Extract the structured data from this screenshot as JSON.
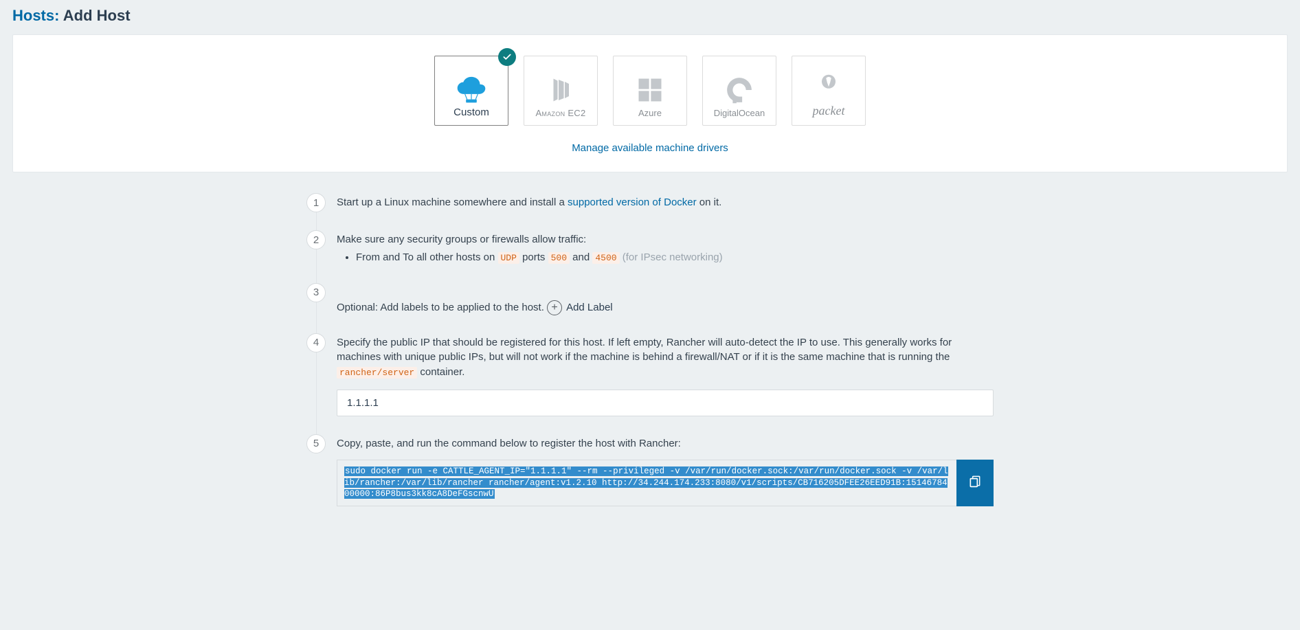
{
  "page": {
    "title_link": "Hosts:",
    "title_rest": " Add Host"
  },
  "drivers": {
    "custom": "Custom",
    "ec2": "Amazon EC2",
    "azure": "Azure",
    "digitalocean": "DigitalOcean",
    "packet": "packet"
  },
  "manage_drivers_link": "Manage available machine drivers",
  "steps": {
    "s1_pre": "Start up a Linux machine somewhere and install a ",
    "s1_link": "supported version of Docker",
    "s1_post": " on it.",
    "s2_intro": "Make sure any security groups or firewalls allow traffic:",
    "s2_li_pre": "From and To all other hosts on ",
    "s2_udp": "UDP",
    "s2_ports_word": " ports ",
    "s2_port1": "500",
    "s2_and": " and ",
    "s2_port2": "4500",
    "s2_note": " (for IPsec networking)",
    "s3": "Optional: Add labels to be applied to the host.",
    "add_label": "Add Label",
    "s4_pre": "Specify the public IP that should be registered for this host. If left empty, Rancher will auto-detect the IP to use. This generally works for machines with unique public IPs, but will not work if the machine is behind a firewall/NAT or if it is the same machine that is running the ",
    "s4_code": "rancher/server",
    "s4_post": " container.",
    "ip_value": "1.1.1.1",
    "s5": "Copy, paste, and run the command below to register the host with Rancher:",
    "cmd": "sudo docker run -e CATTLE_AGENT_IP=\"1.1.1.1\"  --rm --privileged -v /var/run/docker.sock:/var/run/docker.sock -v /var/lib/rancher:/var/lib/rancher rancher/agent:v1.2.10 http://34.244.174.233:8080/v1/scripts/CB716205DFEE26EED91B:1514678400000:86P8bus3kk8cA8DeFGscnwU"
  }
}
